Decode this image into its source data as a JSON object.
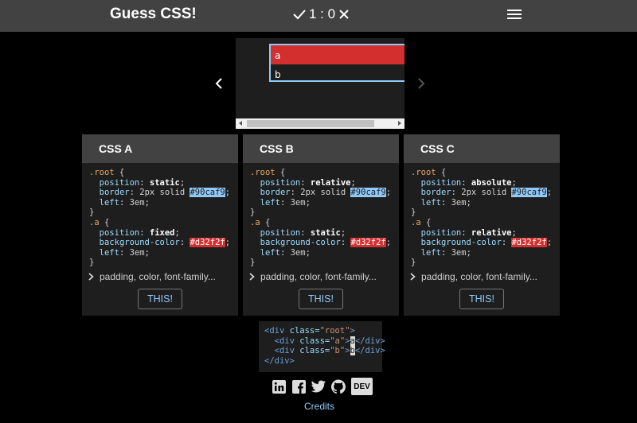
{
  "header": {
    "title": "Guess CSS!",
    "score": "1 : 0"
  },
  "preview": {
    "row_a": "a",
    "row_b": "b"
  },
  "options": [
    {
      "label": "CSS A",
      "root": {
        "selector": ".root",
        "position": "static",
        "border": "2px solid",
        "border_color": "#90caf9",
        "left": "3em"
      },
      "a": {
        "selector": ".a",
        "position": "fixed",
        "background_color": "#d32f2f",
        "left": "3em"
      },
      "more": "padding, color, font-family...",
      "button": "THIS!"
    },
    {
      "label": "CSS B",
      "root": {
        "selector": ".root",
        "position": "relative",
        "border": "2px solid",
        "border_color": "#90caf9",
        "left": "3em"
      },
      "a": {
        "selector": ".a",
        "position": "static",
        "background_color": "#d32f2f",
        "left": "3em"
      },
      "more": "padding, color, font-family...",
      "button": "THIS!"
    },
    {
      "label": "CSS C",
      "root": {
        "selector": ".root",
        "position": "absolute",
        "border": "2px solid",
        "border_color": "#90caf9",
        "left": "3em"
      },
      "a": {
        "selector": ".a",
        "position": "relative",
        "background_color": "#d32f2f",
        "left": "3em"
      },
      "more": "padding, color, font-family...",
      "button": "THIS!"
    }
  ],
  "html_snippet": {
    "root_class": "root",
    "a_class": "a",
    "a_text": "a",
    "b_class": "b",
    "b_text": "b"
  },
  "footer": {
    "icons": [
      "linkedin-icon",
      "facebook-icon",
      "twitter-icon",
      "github-icon",
      "dev-icon"
    ],
    "dev_label": "DEV",
    "credits": "Credits"
  },
  "colors": {
    "accent": "#90caf9",
    "red": "#d32f2f",
    "header": "#424242",
    "panel": "#1e1e1e"
  }
}
